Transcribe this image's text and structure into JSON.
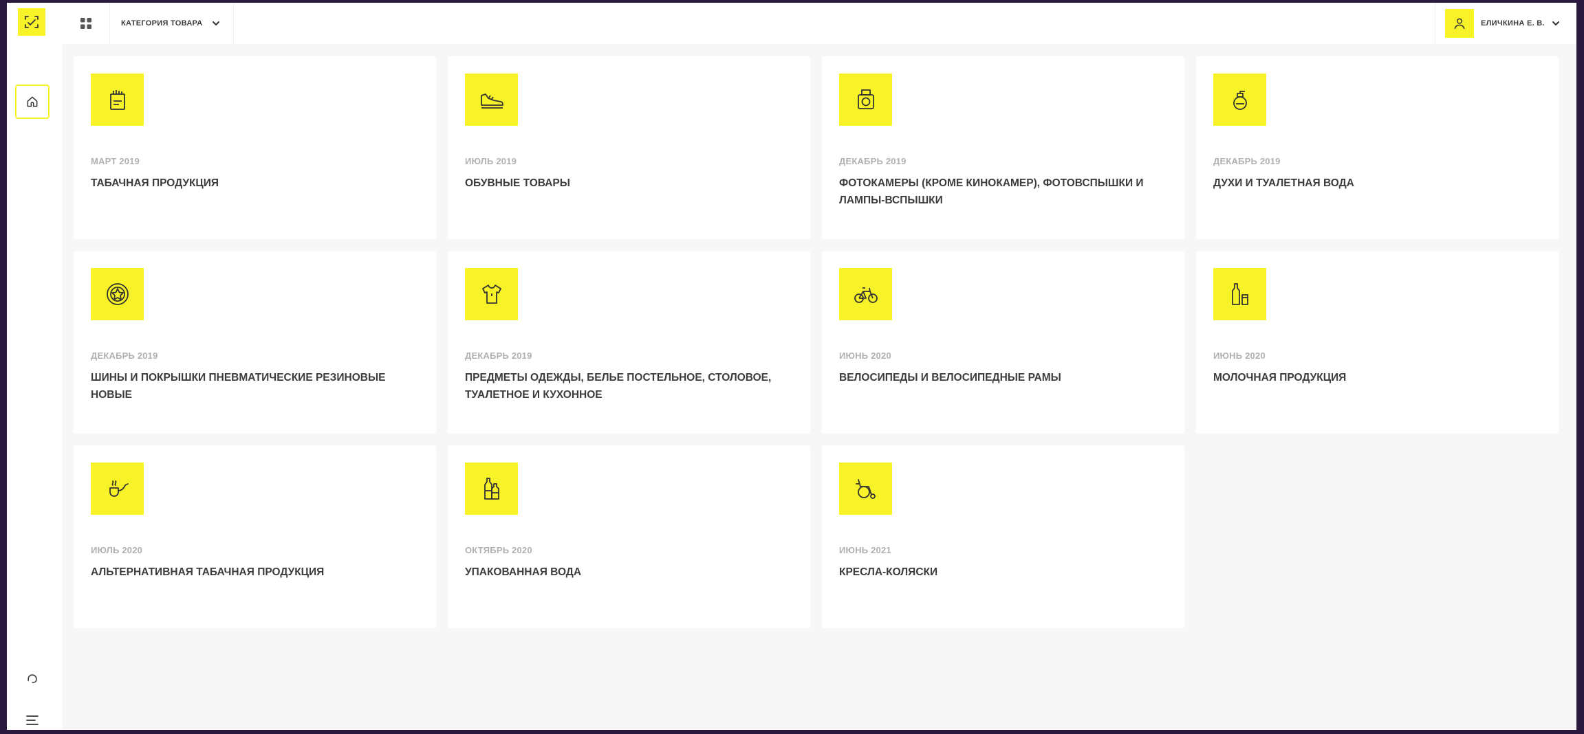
{
  "header": {
    "category_label": "КАТЕГОРИЯ ТОВАРА",
    "user_name": "ЕЛИЧКИНА Е. В."
  },
  "colors": {
    "accent": "#f8f328",
    "background": "#f7f7f7",
    "card": "#ffffff",
    "date_text": "#b0b0b0",
    "title_text": "#3c3c3c",
    "outer_frame": "#2a1a3e"
  },
  "icons": {
    "logo": "scan-code-icon",
    "apps": "apps-grid-icon",
    "dropdown": "chevron-down-icon",
    "user": "user-icon",
    "home": "home-icon",
    "support": "support-icon",
    "menu": "menu-icon"
  },
  "categories": [
    {
      "date": "МАРТ 2019",
      "title": "ТАБАЧНАЯ ПРОДУКЦИЯ",
      "icon": "cigarette-pack-icon"
    },
    {
      "date": "ИЮЛЬ 2019",
      "title": "ОБУВНЫЕ ТОВАРЫ",
      "icon": "shoe-icon"
    },
    {
      "date": "ДЕКАБРЬ 2019",
      "title": "ФОТОКАМЕРЫ (КРОМЕ КИНОКАМЕР), ФОТОВСПЫШКИ И ЛАМПЫ-ВСПЫШКИ",
      "icon": "camera-icon"
    },
    {
      "date": "ДЕКАБРЬ 2019",
      "title": "ДУХИ И ТУАЛЕТНАЯ ВОДА",
      "icon": "perfume-icon"
    },
    {
      "date": "ДЕКАБРЬ 2019",
      "title": "ШИНЫ И ПОКРЫШКИ ПНЕВМАТИЧЕСКИЕ РЕЗИНОВЫЕ НОВЫЕ",
      "icon": "tire-icon"
    },
    {
      "date": "ДЕКАБРЬ 2019",
      "title": "ПРЕДМЕТЫ ОДЕЖДЫ, БЕЛЬЕ ПОСТЕЛЬНОЕ, СТОЛОВОЕ, ТУАЛЕТНОЕ И КУХОННОЕ",
      "icon": "shirt-icon"
    },
    {
      "date": "ИЮНЬ 2020",
      "title": "ВЕЛОСИПЕДЫ И ВЕЛОСИПЕДНЫЕ РАМЫ",
      "icon": "bicycle-icon"
    },
    {
      "date": "ИЮНЬ 2020",
      "title": "МОЛОЧНАЯ ПРОДУКЦИЯ",
      "icon": "milk-icon"
    },
    {
      "date": "ИЮЛЬ 2020",
      "title": "АЛЬТЕРНАТИВНАЯ ТАБАЧНАЯ ПРОДУКЦИЯ",
      "icon": "pipe-icon"
    },
    {
      "date": "ОКТЯБРЬ 2020",
      "title": "УПАКОВАННАЯ ВОДА",
      "icon": "water-bottles-icon"
    },
    {
      "date": "ИЮНЬ 2021",
      "title": "КРЕСЛА-КОЛЯСКИ",
      "icon": "wheelchair-icon"
    }
  ]
}
